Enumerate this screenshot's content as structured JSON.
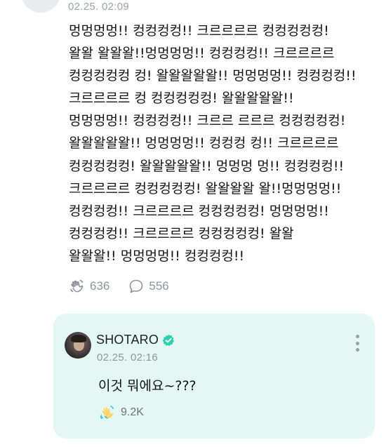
{
  "post": {
    "time": "02.25. 02:09",
    "lines": [
      "멍멍멍멍!! 컹컹컹컹!! 크르르르르 컹컹컹컹컹!",
      "왈왈 왈왈왈!!멍멍멍멍!! 컹컹컹컹!! 크르르르르",
      "컹컹컹컹컹 컹! 왈왈왈왈왈!! 멍멍멍멍!! 컹컹컹컹!!",
      "크르르르르 컹 컹컹컹컹컹! 왈왈왈왈왈!!",
      "멍멍멍멍!! 컹컹컹컹!! 크르르 르르르 컹컹컹컹컹!",
      "왈왈왈왈왈!! 멍멍멍멍!! 컹컹컹 컹!! 크르르르르",
      "컹컹컹컹컹! 왈왈왈왈왈!! 멍멍멍 멍!! 컹컹컹컹!!",
      "크르르르르 컹컹컹컹컹! 왈왈왈왈 왈!!멍멍멍멍!!",
      "컹컹컹컹!! 크르르르르 컹컹컹컹컹! 멍멍멍멍!!",
      "컹컹컹컹!! 크르르르르 컹컹컹컹컹! 왈왈",
      "왈왈왈!! 멍멍멍멍!! 컹컹컹컹!!"
    ],
    "like_count": "636",
    "comment_count": "556"
  },
  "reply": {
    "author": "SHOTARO",
    "time": "02.25. 02:16",
    "text": "이것 뭐에요~???",
    "like_count": "9.2K"
  },
  "colors": {
    "reply_background": "#e3f8f2",
    "verified_badge": "#2fd0b1",
    "muted_text": "#8f949b"
  },
  "icons": {
    "post_like": "hand-wave-icon",
    "post_comment": "speech-bubble-icon",
    "reply_like": "colored-hand-wave-icon",
    "verified": "verified-badge-icon",
    "menu": "more-vertical-icon"
  }
}
